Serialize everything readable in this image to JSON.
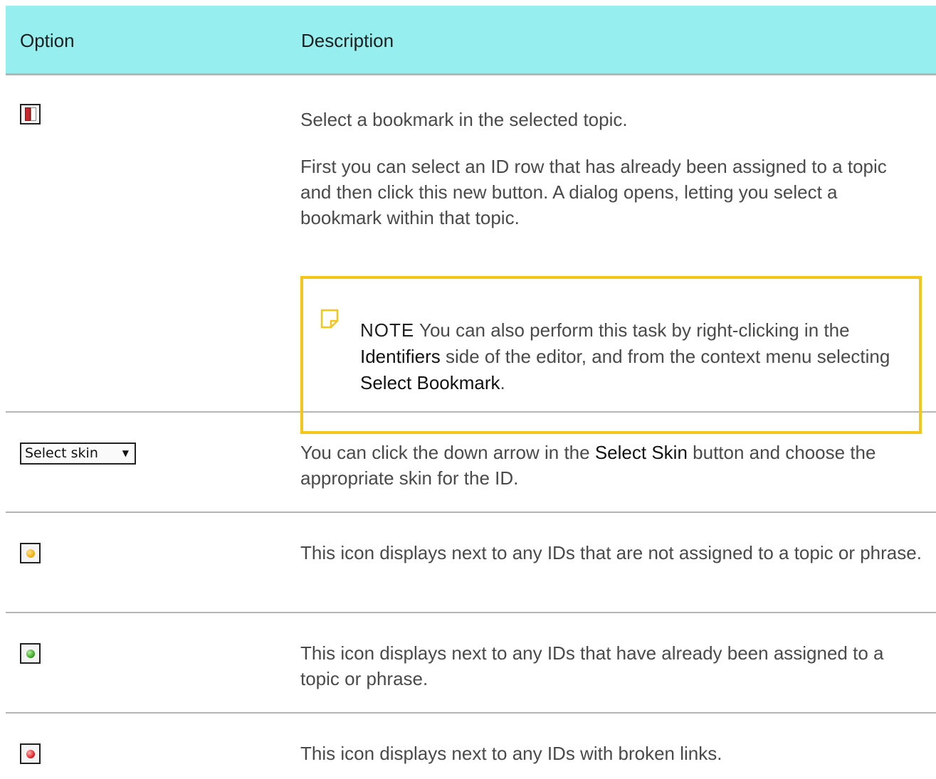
{
  "header": {
    "option": "Option",
    "description": "Description"
  },
  "rows": [
    {
      "icon": "bookmark-book-icon",
      "paragraphs": [
        "Select a bookmark in the selected topic.",
        "First you can select an ID row that has already been assigned to a topic and then click this new button. A dialog opens, letting you select a bookmark within that topic."
      ],
      "note": {
        "label": "NOTE",
        "text_before": " You can also perform this task by right-clicking in the ",
        "bold_1": "Identifiers",
        "text_middle": " side of the editor, and from the context menu selecting ",
        "bold_2": "Select Bookmark",
        "text_after": "."
      }
    },
    {
      "select_label": "Select skin",
      "text_before": "You can click the down arrow in the ",
      "bold": "Select Skin",
      "text_after": " button and choose the appropriate skin for the ID."
    },
    {
      "icon": "yellow-dot-icon",
      "text": "This icon displays next to any IDs that are not assigned to a topic or phrase."
    },
    {
      "icon": "green-dot-icon",
      "text": "This icon displays next to any IDs that have already been assigned to a topic or phrase."
    },
    {
      "icon": "red-dot-icon",
      "text": "This icon displays next to any IDs with broken links."
    }
  ],
  "colors": {
    "header_bg": "#96eeee",
    "note_border": "#f5c518",
    "row_divider": "#b5b5b5"
  }
}
